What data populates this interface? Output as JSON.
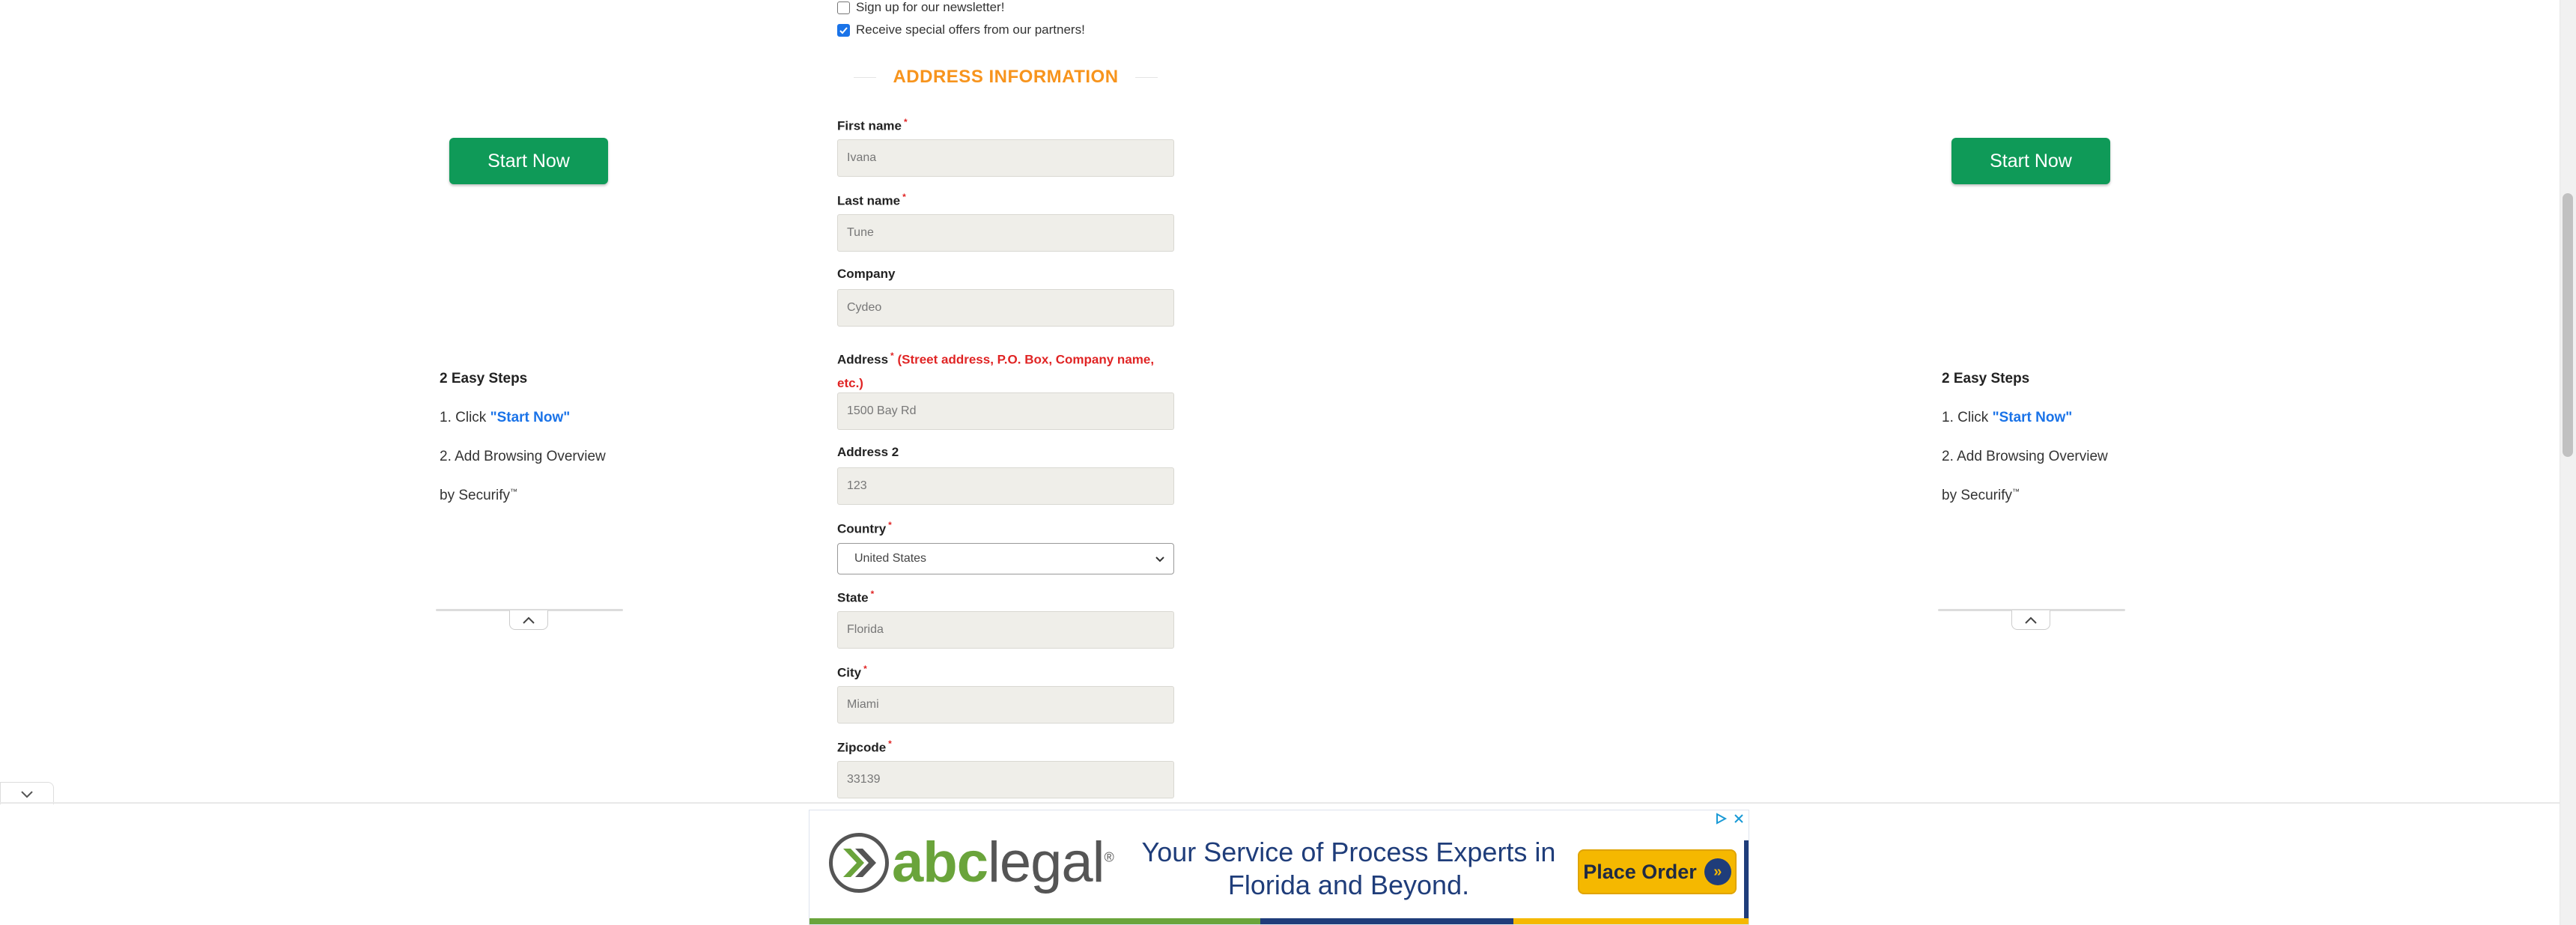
{
  "form": {
    "newsletter": {
      "label": "Sign up for our newsletter!",
      "checked": false
    },
    "partners": {
      "label": "Receive special offers from our partners!",
      "checked": true
    },
    "section_title": "ADDRESS INFORMATION",
    "required_mark": "*",
    "fields": {
      "first_name": {
        "label": "First name",
        "value": "Ivana"
      },
      "last_name": {
        "label": "Last name",
        "value": "Tune"
      },
      "company": {
        "label": "Company",
        "value": "Cydeo"
      },
      "address": {
        "label": "Address",
        "hint": "(Street address, P.O. Box, Company name,",
        "hint2": "etc.)",
        "value": "1500 Bay Rd"
      },
      "address2": {
        "label": "Address 2",
        "value": "123"
      },
      "country": {
        "label": "Country",
        "value": "United States"
      },
      "state": {
        "label": "State",
        "value": "Florida"
      },
      "city": {
        "label": "City",
        "value": "Miami"
      },
      "zipcode": {
        "label": "Zipcode",
        "value": "33139"
      }
    }
  },
  "side_ad": {
    "button_label": "Start Now",
    "steps_title": "2 Easy Steps",
    "step1_prefix": "1. Click ",
    "step1_link": "\"Start Now\"",
    "step2": "2. Add Browsing Overview",
    "byline": "by Securify",
    "trademark": "™"
  },
  "bottom_ad": {
    "brand_abc": "abc",
    "brand_legal": "legal",
    "registered": "®",
    "headline_line1": "Your Service of Process Experts in",
    "headline_line2": "Florida and Beyond.",
    "cta": "Place Order",
    "colors": {
      "green": "#6aa43b",
      "navy": "#1f3d7a",
      "yellow": "#f5b800"
    }
  },
  "colors": {
    "primary_green": "#0f9a58",
    "section_orange": "#f7941d",
    "required_red": "#e02424",
    "link_blue": "#1a73e8"
  },
  "icons": [
    "chevron-up-icon",
    "chevron-down-icon",
    "adchoices-icon",
    "close-icon",
    "double-arrow-icon",
    "checkmark-icon"
  ]
}
